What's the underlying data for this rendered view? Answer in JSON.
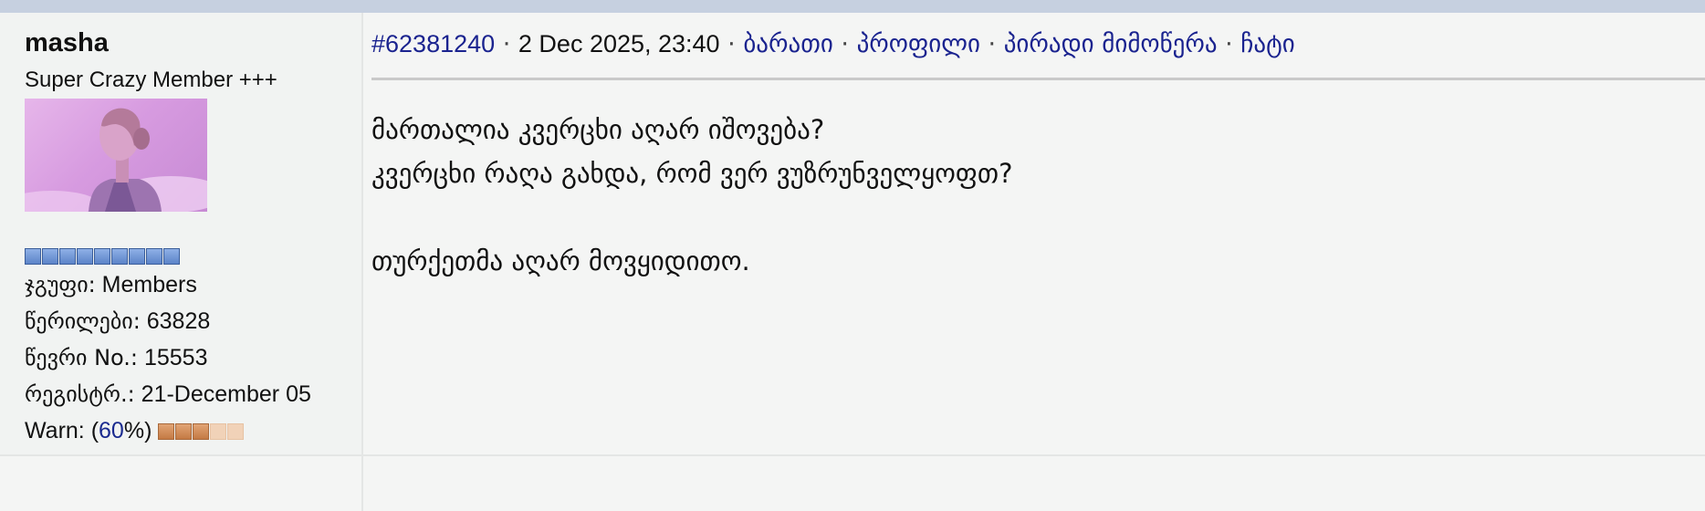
{
  "post": {
    "author": {
      "username": "masha",
      "rank": "Super Crazy Member +++",
      "rank_pips": 9,
      "stats": {
        "group_label": "ჯგუფი:",
        "group_value": "Members",
        "posts_label": "წერილები:",
        "posts_value": "63828",
        "member_no_label": "წევრი No.:",
        "member_no_value": "15553",
        "registered_label": "რეგისტრ.:",
        "registered_value": "21-December 05",
        "warn_label": "Warn: (",
        "warn_percent": "60",
        "warn_suffix": "%)",
        "warn_level_filled": 3,
        "warn_level_total": 5
      }
    },
    "header": {
      "post_id": "#62381240",
      "sep1": " · ",
      "date": "2 Dec 2025, 23:40",
      "sep2": " · ",
      "link_card": "ბარათი",
      "sep3": " · ",
      "link_profile": "პროფილი",
      "sep4": " · ",
      "link_pm": "პირადი მიმოწერა",
      "sep5": " · ",
      "link_chat": "ჩატი"
    },
    "body_lines": [
      "მართალია კვერცხი აღარ იშოვება?",
      "კვერცხი რაღა გახდა, რომ ვერ ვუზრუნველყოფთ?",
      "",
      "თურქეთმა აღარ მოვყიდითო."
    ]
  },
  "colors": {
    "link": "#1a238f",
    "topbar": "#c6d0e0",
    "rank_pip": "#5c84c9",
    "warn_pip_on": "#c47a44",
    "warn_pip_off": "#f1d2b8"
  }
}
